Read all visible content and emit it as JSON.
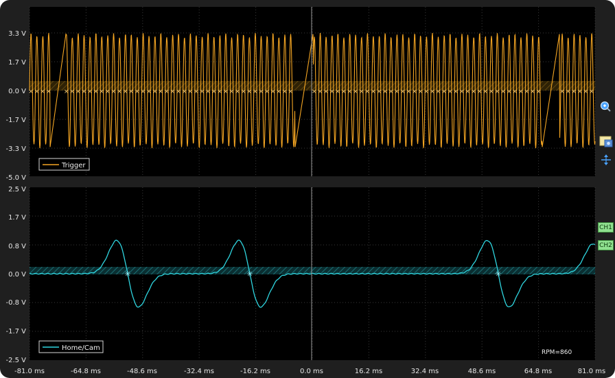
{
  "top_panel": {
    "y_ticks": [
      "3.3 V",
      "1.7 V",
      "0.0 V",
      "-1.7 V",
      "-3.3 V",
      "-5.0 V"
    ],
    "legend": "Trigger",
    "trace_color": "#f5a623"
  },
  "bottom_panel": {
    "y_ticks": [
      "2.5 V",
      "1.7 V",
      "0.8 V",
      "0.0 V",
      "-0.8 V",
      "-1.7 V",
      "-2.5 V"
    ],
    "legend": "Home/Cam",
    "trace_color": "#2fd6e0"
  },
  "x_ticks": [
    "-81.0 ms",
    "-64.8 ms",
    "-48.6 ms",
    "-32.4 ms",
    "-16.2 ms",
    "0.0 ms",
    "16.2 ms",
    "32.4 ms",
    "48.6 ms",
    "64.8 ms",
    "81.0 ms"
  ],
  "rpm_label": "RPM=860",
  "channels": [
    "CH1",
    "CH2"
  ],
  "toolbar_icons": [
    "zoom-icon",
    "screenshot-icon",
    "cursor-split-icon"
  ]
}
